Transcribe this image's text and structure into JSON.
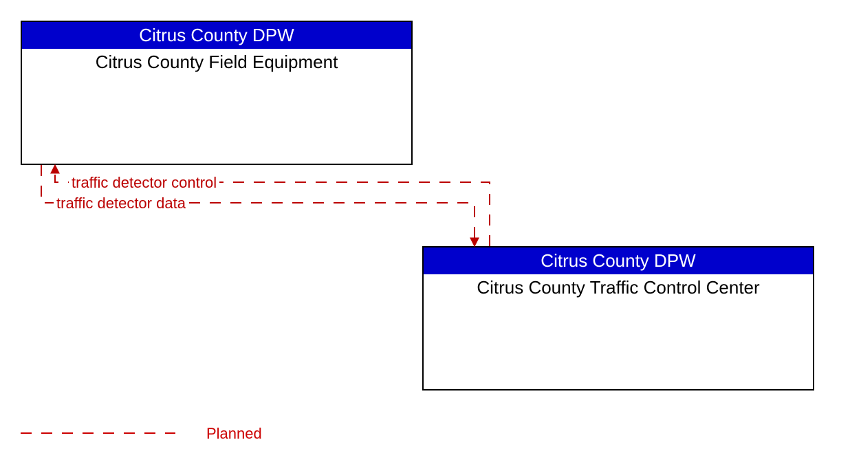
{
  "boxes": {
    "top": {
      "header": "Citrus County DPW",
      "title": "Citrus County Field Equipment"
    },
    "bottom": {
      "header": "Citrus County DPW",
      "title": "Citrus County Traffic Control Center"
    }
  },
  "flows": {
    "to_top": "traffic detector control",
    "to_bottom": "traffic detector data"
  },
  "legend": {
    "planned": "Planned"
  },
  "colors": {
    "header_bg": "#0000cc",
    "flow": "#bb0000"
  }
}
